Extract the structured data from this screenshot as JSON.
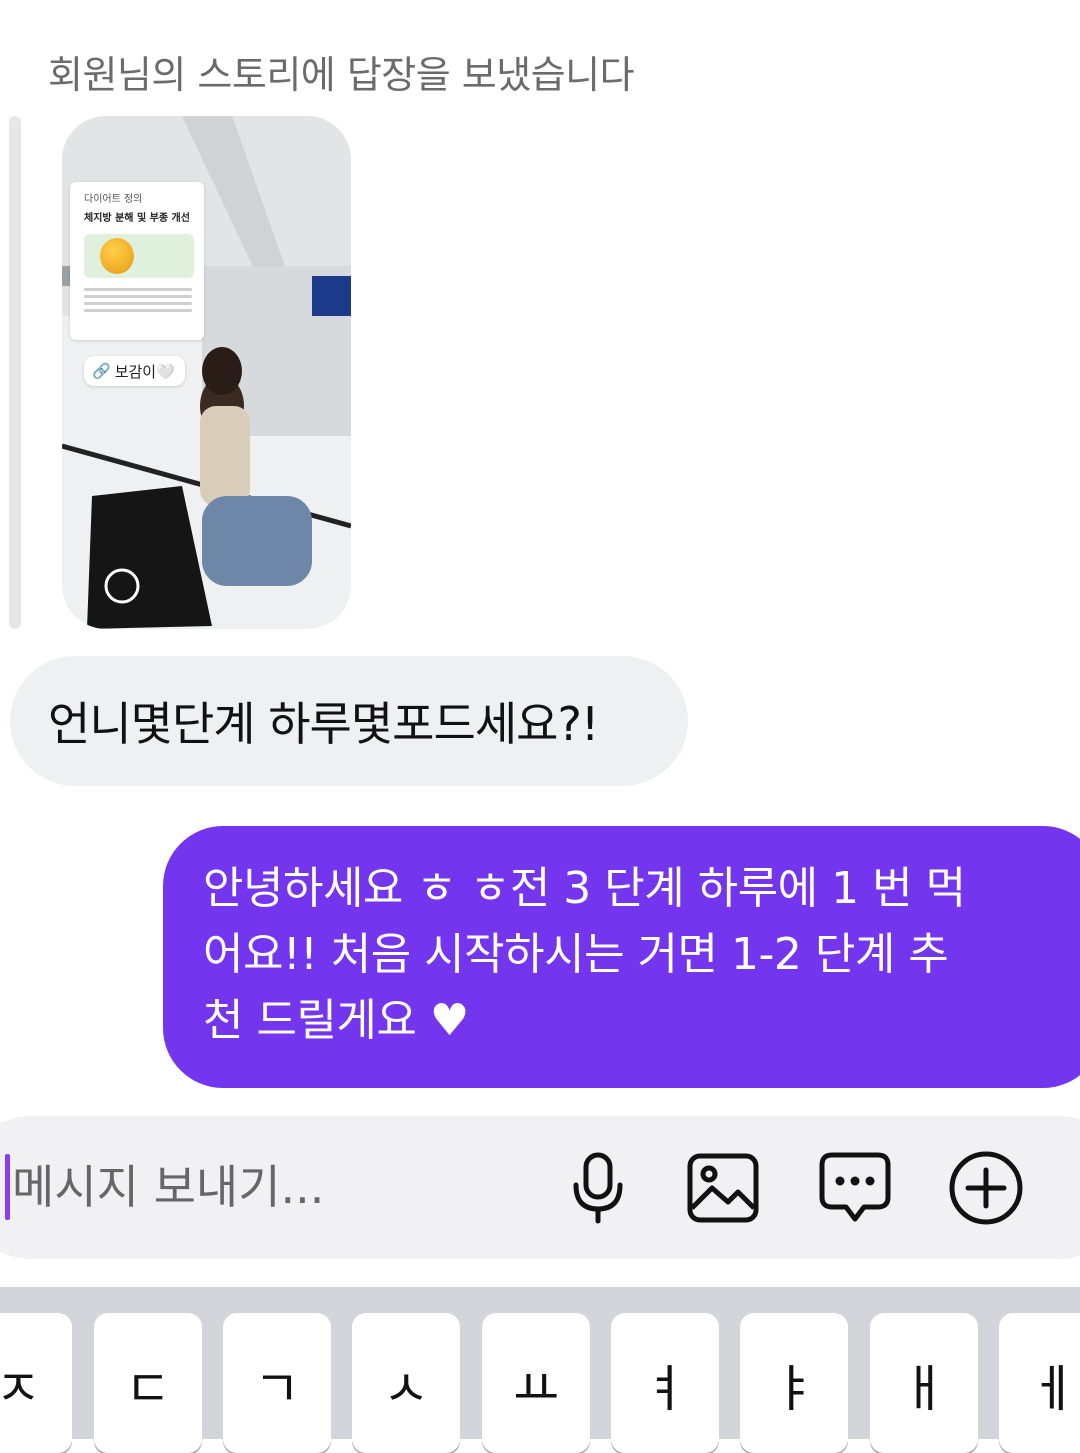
{
  "reply_note": "회원님의 스토리에 답장을 보냈습니다",
  "story": {
    "card_title_small": "다이어트 정의",
    "card_title": "체지방 분해 및 부종 개선",
    "tag_label": "보감이🤍"
  },
  "messages": {
    "received": "언니몇단계 하루몇포드세요?!",
    "sent_lines": [
      "안녕하세요 ㅎ ㅎ전 3 단계 하루에 1 번 먹",
      "어요!! 처음 시작하시는 거면 1-2 단계 추",
      "천 드릴게요 ♥"
    ]
  },
  "composer": {
    "placeholder": "메시지 보내기...",
    "value": ""
  },
  "icons": {
    "mic": "microphone-icon",
    "image": "image-icon",
    "sticker": "chat-bubble-icon",
    "add": "plus-circle-icon"
  },
  "keyboard": {
    "keys": [
      "ㅈ",
      "ㄷ",
      "ㄱ",
      "ㅅ",
      "ㅛ",
      "ㅕ",
      "ㅑ",
      "ㅐ",
      "ㅔ"
    ]
  },
  "colors": {
    "sent_bubble": "#7435ee",
    "received_bubble": "#eff0f2",
    "caret": "#8b3bf2"
  }
}
